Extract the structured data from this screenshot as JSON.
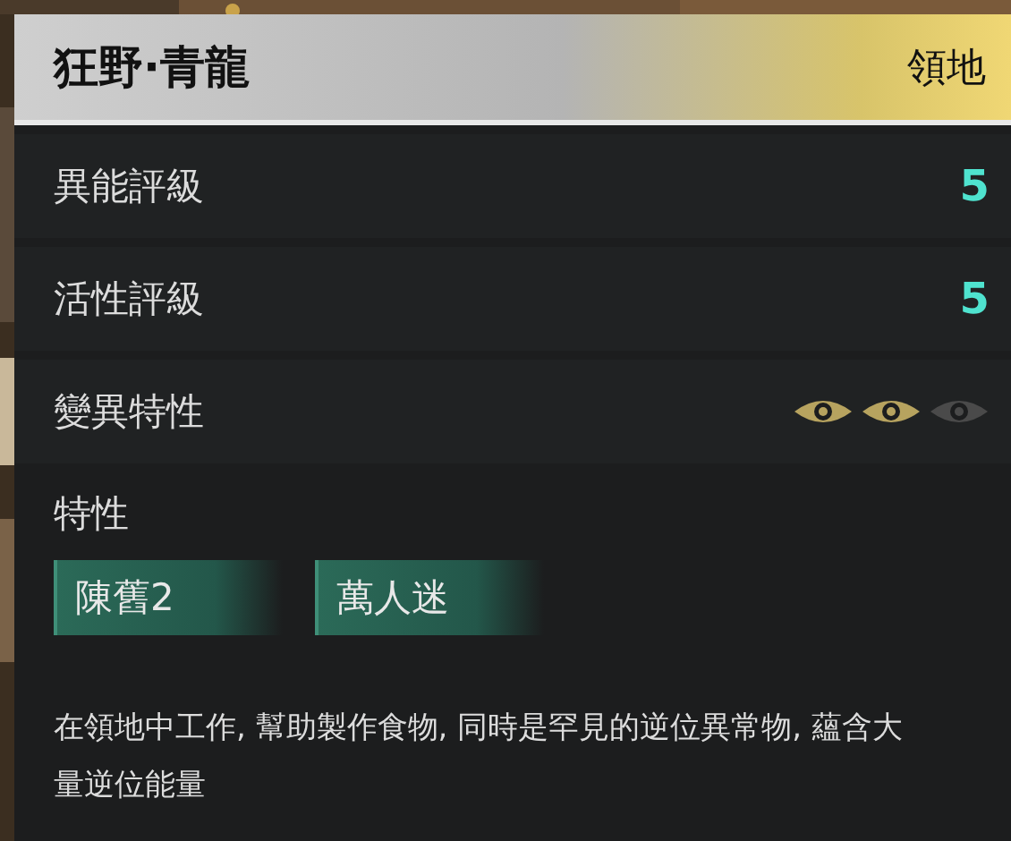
{
  "header": {
    "title": "狂野·青龍",
    "category": "領地"
  },
  "stats": [
    {
      "label": "異能評級",
      "value": "5"
    },
    {
      "label": "活性評級",
      "value": "5"
    }
  ],
  "mutation": {
    "label": "變異特性",
    "eyes": [
      {
        "on": true
      },
      {
        "on": true
      },
      {
        "on": false
      }
    ]
  },
  "traits": {
    "label": "特性",
    "tags": [
      "陳舊2",
      "萬人迷"
    ]
  },
  "description": "在領地中工作, 幫助製作食物, 同時是罕見的逆位異常物, 蘊含大量逆位能量"
}
